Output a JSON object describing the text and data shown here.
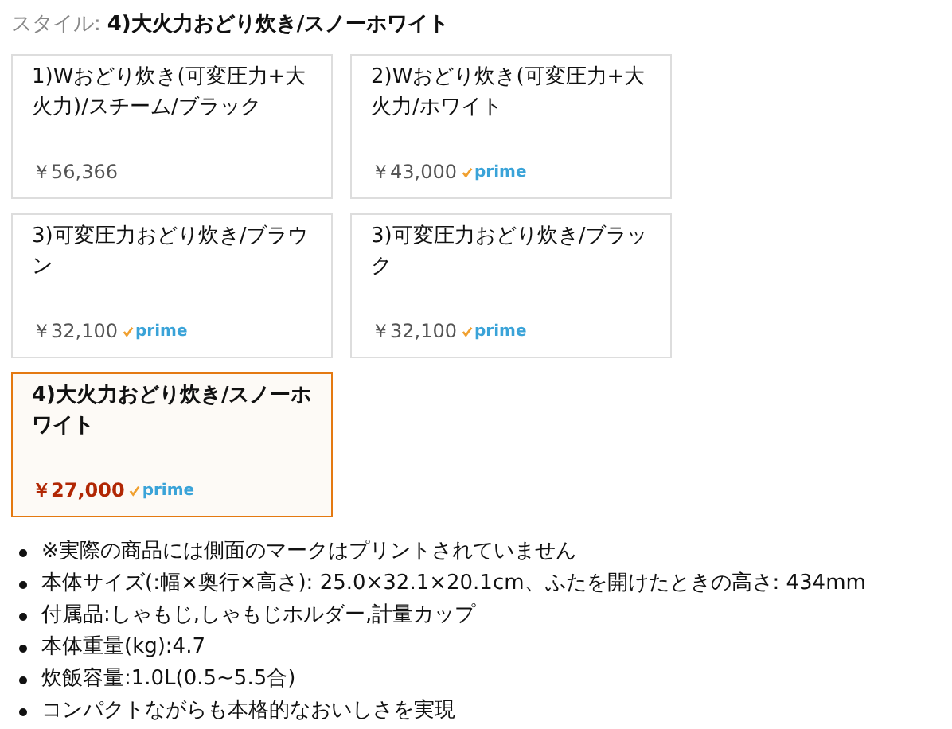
{
  "style_label": "スタイル:",
  "style_value": "4)大火力おどり炊き/スノーホワイト",
  "options": [
    {
      "title": "1)Wおどり炊き(可変圧力+大火力)/スチーム/ブラック",
      "price": "￥56,366",
      "selected": false
    },
    {
      "title": "2)Wおどり炊き(可変圧力+大火力/ホワイト",
      "price": "￥43,000",
      "badge": "prime",
      "selected": false
    },
    {
      "title": "3)可変圧力おどり炊き/ブラウン",
      "price": "￥32,100",
      "badge": "prime",
      "selected": false
    },
    {
      "title": "3)可変圧力おどり炊き/ブラック",
      "price": "￥32,100",
      "badge": "prime",
      "selected": false
    },
    {
      "title": "4)大火力おどり炊き/スノーホワイト",
      "price": "￥27,000",
      "badge": "prime",
      "selected": true
    }
  ],
  "features": [
    "※実際の商品には側面のマークはプリントされていません",
    "本体サイズ(:幅×奥行×高さ): 25.0×32.1×20.1cm、ふたを開けたときの高さ: 434mm",
    "付属品:しゃもじ,しゃもじホルダー,計量カップ",
    "本体重量(kg):4.7",
    "炊飯容量:1.0L(0.5~5.5合)",
    "コンパクトながらも本格的なおいしさを実現"
  ]
}
